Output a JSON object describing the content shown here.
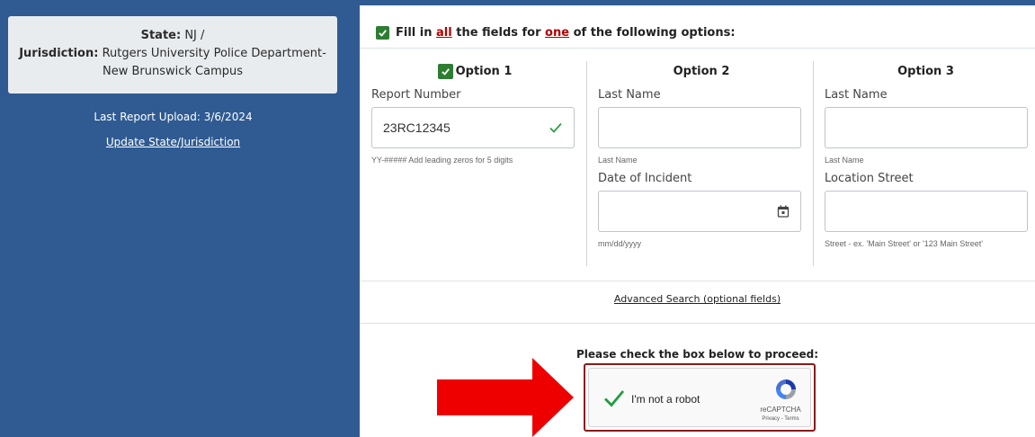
{
  "sidebar": {
    "state_label": "State:",
    "state_value": "NJ /",
    "jurisdiction_label": "Jurisdiction:",
    "jurisdiction_value": "Rutgers University Police Department-New Brunswick Campus",
    "last_upload": "Last Report Upload: 3/6/2024",
    "update_link": "Update State/Jurisdiction"
  },
  "instructions": {
    "part1": "Fill in ",
    "all": "all",
    "part2": " the fields for ",
    "one": "one",
    "part3": " of the following options:"
  },
  "options": {
    "option1": {
      "title": "Option 1",
      "report_label": "Report Number",
      "report_value": "23RC12345",
      "report_help": "YY-##### Add leading zeros for 5 digits"
    },
    "option2": {
      "title": "Option 2",
      "lastname_label": "Last Name",
      "lastname_help": "Last Name",
      "date_label": "Date of Incident",
      "date_help": "mm/dd/yyyy"
    },
    "option3": {
      "title": "Option 3",
      "lastname_label": "Last Name",
      "lastname_help": "Last Name",
      "street_label": "Location Street",
      "street_help": "Street - ex. 'Main Street' or '123 Main Street'"
    }
  },
  "advanced_search": "Advanced Search (optional fields)",
  "captcha": {
    "prompt": "Please check the box below to proceed:",
    "label": "I'm not a robot",
    "brand": "reCAPTCHA",
    "terms": "Privacy - Terms"
  },
  "colors": {
    "sidebar_bg": "#2f5b92",
    "check_green": "#2e7d32",
    "arrow_red": "#ee0000",
    "captcha_border": "#8b1a1a"
  }
}
